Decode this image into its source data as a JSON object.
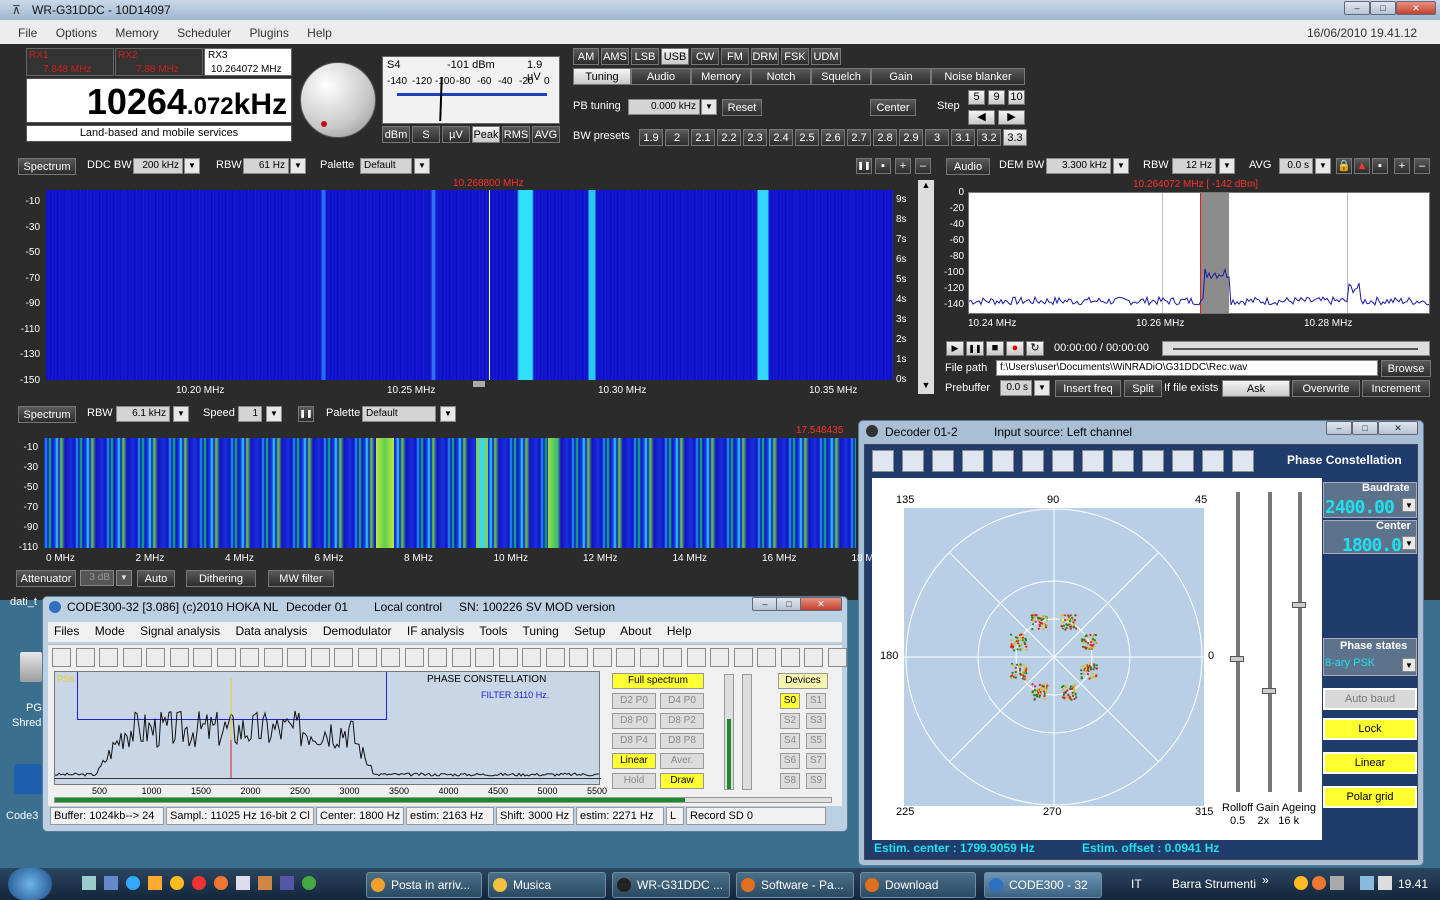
{
  "app": {
    "title": "WR-G31DDC - 10D14097",
    "menu": [
      "File",
      "Options",
      "Memory",
      "Scheduler",
      "Plugins",
      "Help"
    ],
    "datetime": "16/06/2010 19.41.12"
  },
  "receivers": [
    {
      "name": "RX1",
      "freq": "7.848 MHz"
    },
    {
      "name": "RX2",
      "freq": "7.88 MHz"
    },
    {
      "name": "RX3",
      "freq": "10.264072 MHz"
    }
  ],
  "frequency": {
    "big": "10264",
    "small": ".072",
    "unit": "kHz",
    "service": "Land-based and mobile services"
  },
  "smeter": {
    "label": "S4",
    "dbm": "-101 dBm",
    "uv": "1.9 µV",
    "scale": [
      "-140",
      "-120",
      "-100",
      "-80",
      "-60",
      "-40",
      "-20",
      "0"
    ],
    "buttons": [
      "dBm",
      "S",
      "µV",
      "Peak",
      "RMS",
      "AVG"
    ],
    "active": "Peak"
  },
  "modes": {
    "items": [
      "AM",
      "AMS",
      "LSB",
      "USB",
      "CW",
      "FM",
      "DRM",
      "FSK",
      "UDM"
    ],
    "active": "USB"
  },
  "tabs": {
    "items": [
      "Tuning",
      "Audio",
      "Memory",
      "Notch",
      "Squelch",
      "Gain",
      "Noise blanker"
    ],
    "active": "Tuning"
  },
  "tuning": {
    "pb_label": "PB tuning",
    "pb_value": "0.000 kHz",
    "reset": "Reset",
    "center": "Center",
    "step_label": "Step",
    "steps": [
      "5",
      "9",
      "10"
    ],
    "bw_label": "BW presets",
    "bw": [
      "1.9",
      "2",
      "2.1",
      "2.2",
      "2.3",
      "2.4",
      "2.5",
      "2.6",
      "2.7",
      "2.8",
      "2.9",
      "3",
      "3.1",
      "3.2",
      "3.3"
    ],
    "bw_active": "3.3"
  },
  "spectrum1": {
    "btn": "Spectrum",
    "ddcbw_label": "DDC BW",
    "ddcbw": "200 kHz",
    "rbw_label": "RBW",
    "rbw": "61 Hz",
    "palette_label": "Palette",
    "palette": "Default",
    "marker": "10.268800 MHz",
    "yticks": [
      "-10",
      "-30",
      "-50",
      "-70",
      "-90",
      "-110",
      "-130",
      "-150"
    ],
    "xticks": [
      "10.20 MHz",
      "10.25 MHz",
      "10.30 MHz",
      "10.35 MHz"
    ],
    "time": [
      "9s",
      "8s",
      "7s",
      "6s",
      "5s",
      "4s",
      "3s",
      "2s",
      "1s",
      "0s"
    ]
  },
  "audio": {
    "btn": "Audio",
    "dembw_label": "DEM BW",
    "dembw": "3.300 kHz",
    "rbw_label": "RBW",
    "rbw": "12 Hz",
    "avg_label": "AVG",
    "avg": "0.0 s",
    "marker": "10.264072 MHz [ -142 dBm]",
    "yticks": [
      "0",
      "-20",
      "-40",
      "-60",
      "-80",
      "-100",
      "-120",
      "-140"
    ],
    "xticks": [
      "10.24 MHz",
      "10.26 MHz",
      "10.28 MHz"
    ]
  },
  "recorder": {
    "time": "00:00:00 / 00:00:00",
    "filepath_label": "File path",
    "filepath": "f:\\Users\\user\\Documents\\WiNRADiO\\G31DDC\\Rec.wav",
    "browse": "Browse",
    "prebuffer_label": "Prebuffer",
    "prebuffer": "0.0 s",
    "insert": "Insert freq",
    "split": "Split",
    "ifexists": "If file exists",
    "ask": "Ask",
    "overwrite": "Overwrite",
    "increment": "Increment"
  },
  "spectrum2": {
    "btn": "Spectrum",
    "rbw_label": "RBW",
    "rbw": "6.1 kHz",
    "speed_label": "Speed",
    "speed": "1",
    "palette_label": "Palette",
    "palette": "Default",
    "marker": "17.548435",
    "yticks": [
      "-10",
      "-30",
      "-50",
      "-70",
      "-90",
      "-110"
    ],
    "xticks": [
      "0 MHz",
      "2 MHz",
      "4 MHz",
      "6 MHz",
      "8 MHz",
      "10 MHz",
      "12 MHz",
      "14 MHz",
      "16 MHz",
      "18 M"
    ]
  },
  "bottombar": {
    "attenuator": "Attenuator",
    "att_val": "3 dB",
    "auto": "Auto",
    "dithering": "Dithering",
    "mwfilter": "MW filter"
  },
  "desktop": {
    "label1": "dati_t",
    "label2": "PG",
    "label3": "Shred",
    "label4": "Code3"
  },
  "code300": {
    "title": "CODE300-32 [3.086] (c)2010 HOKA NL",
    "decoder": "Decoder 01",
    "control": "Local control",
    "sn": "SN: 100226 SV MOD version",
    "menu": [
      "Files",
      "Mode",
      "Signal analysis",
      "Data analysis",
      "Demodulator",
      "IF analysis",
      "Tools",
      "Tuning",
      "Setup",
      "About",
      "Help"
    ],
    "psk": "PSK",
    "plotlabel": "PHASE CONSTELLATION",
    "filter": "FILTER 3110 Hz.",
    "xticks": [
      "500",
      "1000",
      "1500",
      "2000",
      "2500",
      "3000",
      "3500",
      "4000",
      "4500",
      "5000",
      "5500"
    ],
    "panel": [
      {
        "label": "Full spectrum",
        "on": true
      }
    ],
    "dbtns": [
      "D2 P0",
      "D4 P0",
      "D8 P0",
      "D8 P2",
      "D8 P4",
      "D8 P8"
    ],
    "linear": "Linear",
    "aver": "Aver.",
    "hold": "Hold",
    "draw": "Draw",
    "devices": "Devices",
    "sbtns": [
      "S0",
      "S1",
      "S2",
      "S3",
      "S4",
      "S5",
      "S6",
      "S7",
      "S8",
      "S9"
    ],
    "status": [
      "Buffer: 1024kb--> 24",
      "Sampl.: 11025 Hz 16-bit 2 Cl",
      "Center: 1800 Hz",
      "estim: 2163 Hz",
      "Shift: 3000 Hz",
      "estim: 2271 Hz",
      "L",
      "Record SD 0"
    ]
  },
  "decoder": {
    "title": "Decoder 01-2",
    "input": "Input source: Left channel",
    "heading": "Phase Constellation",
    "angles": {
      "a135": "135",
      "a90": "90",
      "a45": "45",
      "a180": "180",
      "a0": "0",
      "a225": "225",
      "a270": "270",
      "a315": "315"
    },
    "baud_label": "Baudrate",
    "baud": "2400.00",
    "center_label": "Center",
    "center": "1800.0",
    "states_label": "Phase states",
    "states": "8-ary PSK",
    "autobaud": "Auto baud",
    "lock": "Lock",
    "linear": "Linear",
    "polar": "Polar grid",
    "sliders": "Rolloff Gain Ageing",
    "sliders_vals": "0.5    2x   16 k",
    "estim_center": "Estim. center : 1799.9059 Hz",
    "estim_offset": "Estim. offset : 0.0941 Hz"
  },
  "taskbar": {
    "items": [
      "Posta in arriv...",
      "Musica",
      "WR-G31DDC ...",
      "Software - Pa...",
      "Download",
      "CODE300 - 32"
    ],
    "lang": "IT",
    "strumenti": "Barra Strumenti",
    "time": "19.41"
  }
}
